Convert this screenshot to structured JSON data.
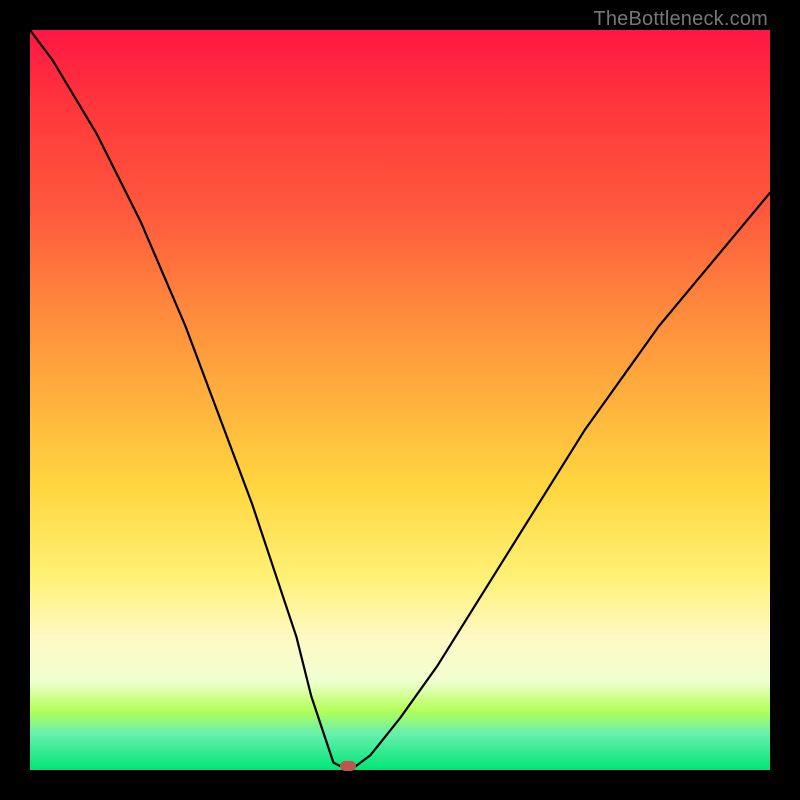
{
  "watermark": {
    "text": "TheBottleneck.com"
  },
  "chart_data": {
    "type": "line",
    "title": "",
    "xlabel": "",
    "ylabel": "",
    "xlim": [
      0,
      100
    ],
    "ylim": [
      0,
      100
    ],
    "background_gradient": [
      "#ff1744",
      "#ffd740",
      "#00e676"
    ],
    "series": [
      {
        "name": "bottleneck-curve",
        "x": [
          0,
          3,
          6,
          9,
          12,
          15,
          18,
          21,
          24,
          27,
          30,
          33,
          36,
          38,
          40,
          41,
          42,
          43,
          44,
          46,
          50,
          55,
          60,
          65,
          70,
          75,
          80,
          85,
          90,
          95,
          100
        ],
        "y": [
          100,
          96,
          91,
          86,
          80,
          74,
          67,
          60,
          52,
          44,
          36,
          27,
          18,
          10,
          4,
          1,
          0.5,
          0.5,
          0.5,
          2,
          7,
          14,
          22,
          30,
          38,
          46,
          53,
          60,
          66,
          72,
          78
        ]
      }
    ],
    "marker": {
      "x": 43,
      "y": 0.5,
      "color": "#c0564b"
    }
  }
}
